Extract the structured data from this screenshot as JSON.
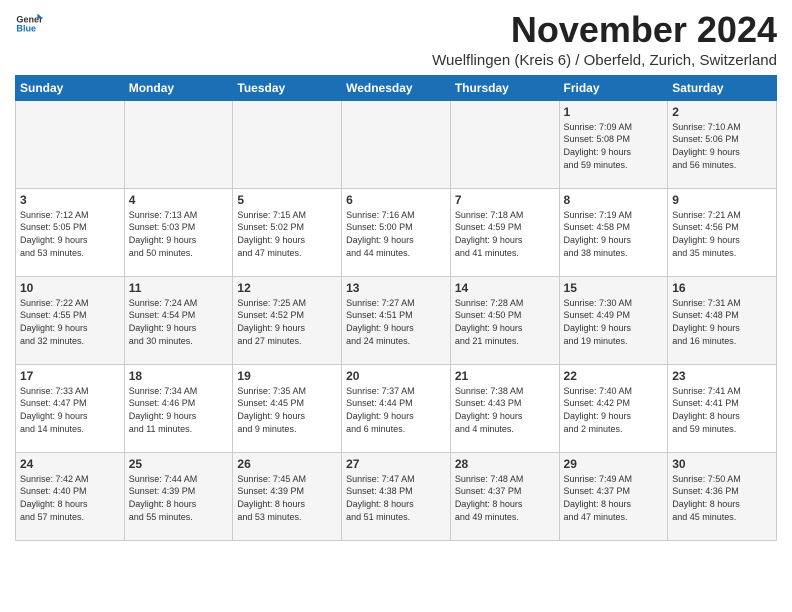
{
  "logo": {
    "text_general": "General",
    "text_blue": "Blue"
  },
  "title": "November 2024",
  "subtitle": "Wuelflingen (Kreis 6) / Oberfeld, Zurich, Switzerland",
  "weekdays": [
    "Sunday",
    "Monday",
    "Tuesday",
    "Wednesday",
    "Thursday",
    "Friday",
    "Saturday"
  ],
  "weeks": [
    [
      {
        "day": "",
        "info": ""
      },
      {
        "day": "",
        "info": ""
      },
      {
        "day": "",
        "info": ""
      },
      {
        "day": "",
        "info": ""
      },
      {
        "day": "",
        "info": ""
      },
      {
        "day": "1",
        "info": "Sunrise: 7:09 AM\nSunset: 5:08 PM\nDaylight: 9 hours\nand 59 minutes."
      },
      {
        "day": "2",
        "info": "Sunrise: 7:10 AM\nSunset: 5:06 PM\nDaylight: 9 hours\nand 56 minutes."
      }
    ],
    [
      {
        "day": "3",
        "info": "Sunrise: 7:12 AM\nSunset: 5:05 PM\nDaylight: 9 hours\nand 53 minutes."
      },
      {
        "day": "4",
        "info": "Sunrise: 7:13 AM\nSunset: 5:03 PM\nDaylight: 9 hours\nand 50 minutes."
      },
      {
        "day": "5",
        "info": "Sunrise: 7:15 AM\nSunset: 5:02 PM\nDaylight: 9 hours\nand 47 minutes."
      },
      {
        "day": "6",
        "info": "Sunrise: 7:16 AM\nSunset: 5:00 PM\nDaylight: 9 hours\nand 44 minutes."
      },
      {
        "day": "7",
        "info": "Sunrise: 7:18 AM\nSunset: 4:59 PM\nDaylight: 9 hours\nand 41 minutes."
      },
      {
        "day": "8",
        "info": "Sunrise: 7:19 AM\nSunset: 4:58 PM\nDaylight: 9 hours\nand 38 minutes."
      },
      {
        "day": "9",
        "info": "Sunrise: 7:21 AM\nSunset: 4:56 PM\nDaylight: 9 hours\nand 35 minutes."
      }
    ],
    [
      {
        "day": "10",
        "info": "Sunrise: 7:22 AM\nSunset: 4:55 PM\nDaylight: 9 hours\nand 32 minutes."
      },
      {
        "day": "11",
        "info": "Sunrise: 7:24 AM\nSunset: 4:54 PM\nDaylight: 9 hours\nand 30 minutes."
      },
      {
        "day": "12",
        "info": "Sunrise: 7:25 AM\nSunset: 4:52 PM\nDaylight: 9 hours\nand 27 minutes."
      },
      {
        "day": "13",
        "info": "Sunrise: 7:27 AM\nSunset: 4:51 PM\nDaylight: 9 hours\nand 24 minutes."
      },
      {
        "day": "14",
        "info": "Sunrise: 7:28 AM\nSunset: 4:50 PM\nDaylight: 9 hours\nand 21 minutes."
      },
      {
        "day": "15",
        "info": "Sunrise: 7:30 AM\nSunset: 4:49 PM\nDaylight: 9 hours\nand 19 minutes."
      },
      {
        "day": "16",
        "info": "Sunrise: 7:31 AM\nSunset: 4:48 PM\nDaylight: 9 hours\nand 16 minutes."
      }
    ],
    [
      {
        "day": "17",
        "info": "Sunrise: 7:33 AM\nSunset: 4:47 PM\nDaylight: 9 hours\nand 14 minutes."
      },
      {
        "day": "18",
        "info": "Sunrise: 7:34 AM\nSunset: 4:46 PM\nDaylight: 9 hours\nand 11 minutes."
      },
      {
        "day": "19",
        "info": "Sunrise: 7:35 AM\nSunset: 4:45 PM\nDaylight: 9 hours\nand 9 minutes."
      },
      {
        "day": "20",
        "info": "Sunrise: 7:37 AM\nSunset: 4:44 PM\nDaylight: 9 hours\nand 6 minutes."
      },
      {
        "day": "21",
        "info": "Sunrise: 7:38 AM\nSunset: 4:43 PM\nDaylight: 9 hours\nand 4 minutes."
      },
      {
        "day": "22",
        "info": "Sunrise: 7:40 AM\nSunset: 4:42 PM\nDaylight: 9 hours\nand 2 minutes."
      },
      {
        "day": "23",
        "info": "Sunrise: 7:41 AM\nSunset: 4:41 PM\nDaylight: 8 hours\nand 59 minutes."
      }
    ],
    [
      {
        "day": "24",
        "info": "Sunrise: 7:42 AM\nSunset: 4:40 PM\nDaylight: 8 hours\nand 57 minutes."
      },
      {
        "day": "25",
        "info": "Sunrise: 7:44 AM\nSunset: 4:39 PM\nDaylight: 8 hours\nand 55 minutes."
      },
      {
        "day": "26",
        "info": "Sunrise: 7:45 AM\nSunset: 4:39 PM\nDaylight: 8 hours\nand 53 minutes."
      },
      {
        "day": "27",
        "info": "Sunrise: 7:47 AM\nSunset: 4:38 PM\nDaylight: 8 hours\nand 51 minutes."
      },
      {
        "day": "28",
        "info": "Sunrise: 7:48 AM\nSunset: 4:37 PM\nDaylight: 8 hours\nand 49 minutes."
      },
      {
        "day": "29",
        "info": "Sunrise: 7:49 AM\nSunset: 4:37 PM\nDaylight: 8 hours\nand 47 minutes."
      },
      {
        "day": "30",
        "info": "Sunrise: 7:50 AM\nSunset: 4:36 PM\nDaylight: 8 hours\nand 45 minutes."
      }
    ]
  ]
}
